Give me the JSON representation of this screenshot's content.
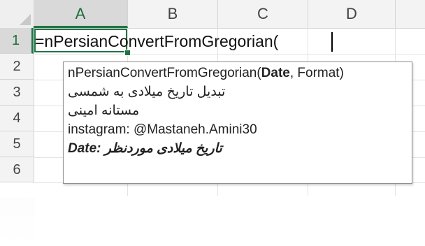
{
  "columns": [
    "A",
    "B",
    "C",
    "D"
  ],
  "rows": [
    "1",
    "2",
    "3",
    "4",
    "5",
    "6"
  ],
  "cell_a1": {
    "formula": "=nPersianConvertFromGregorian("
  },
  "tooltip": {
    "signature_func": "nPersianConvertFromGregorian(",
    "signature_param_active": "Date",
    "signature_rest": ", Format)",
    "line2": "تبدیل تاریخ میلادی به شمسی",
    "line3": "مستانه امینی",
    "line4": "instagram: @Mastaneh.Amini30",
    "line5": "Date: تاریخ میلادی موردنظر"
  },
  "colors": {
    "accent": "#217346"
  }
}
